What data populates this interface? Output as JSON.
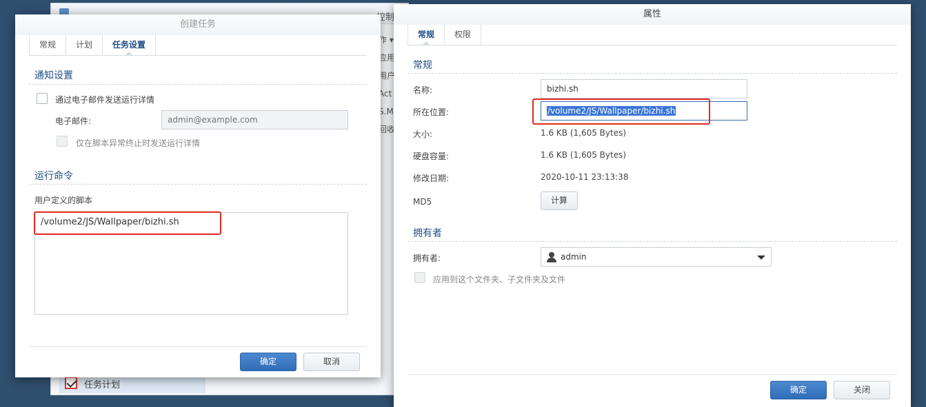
{
  "background_window": {
    "title_fragment": "控制",
    "column_fragments": [
      "作 ▾",
      "应用",
      "用户",
      "Act",
      "S.M",
      "回收"
    ],
    "sidebar_item_label": "任务计划"
  },
  "create_task_dialog": {
    "title": "创建任务",
    "tabs": [
      {
        "label": "常规"
      },
      {
        "label": "计划"
      },
      {
        "label": "任务设置"
      }
    ],
    "notification_section": "通知设置",
    "email_checkbox_label": "通过电子邮件发送运行详情",
    "email_label": "电子邮件:",
    "email_placeholder": "admin@example.com",
    "abnormal_only_label": "仅在脚本异常终止时发送运行详情",
    "run_command_section": "运行命令",
    "user_script_label": "用户定义的脚本",
    "script_value": "/volume2/JS/Wallpaper/bizhi.sh",
    "ok_button": "确定",
    "cancel_button": "取消"
  },
  "properties_dialog": {
    "title": "属性",
    "tabs": [
      {
        "label": "常规"
      },
      {
        "label": "权限"
      }
    ],
    "general_section": "常规",
    "name_label": "名称:",
    "name_value": "bizhi.sh",
    "location_label": "所在位置:",
    "location_value": "/volume2/JS/Wallpaper/bizhi.sh",
    "size_label": "大小:",
    "size_value": "1.6 KB (1,605 Bytes)",
    "disk_usage_label": "硬盘容量:",
    "disk_usage_value": "1.6 KB (1,605 Bytes)",
    "modified_label": "修改日期:",
    "modified_value": "2020-10-11 23:13:38",
    "md5_label": "MD5",
    "calculate_button": "计算",
    "owner_section": "拥有者",
    "owner_label": "拥有者:",
    "owner_value": "admin",
    "apply_recursive_label": "应用到这个文件夹、子文件夹及文件",
    "ok_button": "确定",
    "close_button": "关闭"
  }
}
